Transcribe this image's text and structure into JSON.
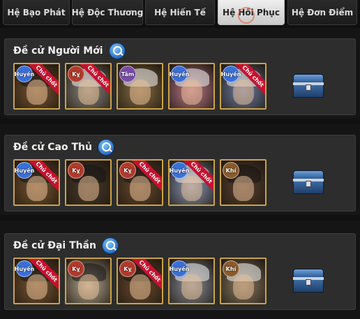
{
  "tabs": [
    {
      "label": "Hệ Bạo Phát",
      "active": false
    },
    {
      "label": "Hệ Độc Thương",
      "active": false
    },
    {
      "label": "Hệ Hiến Tế",
      "active": false
    },
    {
      "label": "Hệ Hồi Phục",
      "active": true
    },
    {
      "label": "Hệ Đơn Điểm",
      "active": false
    }
  ],
  "panels": [
    {
      "title": "Đề cử Người Mới",
      "heroes": [
        {
          "badge": "Huyền",
          "badge_color": "#3a6fd8",
          "ribbon": "Chủ chốt",
          "bg": "#7a5632",
          "hair": "dark"
        },
        {
          "badge": "Kỵ",
          "badge_color": "#b23a2a",
          "ribbon": "Chủ chốt",
          "bg": "#8d8a82",
          "hair": "light"
        },
        {
          "badge": "Tâm",
          "badge_color": "#7a4aa8",
          "ribbon": "",
          "bg": "#8a6e44",
          "hair": "light"
        },
        {
          "badge": "Huyền",
          "badge_color": "#3a6fd8",
          "ribbon": "",
          "bg": "#c07a8c",
          "hair": "light"
        },
        {
          "badge": "Huyền",
          "badge_color": "#3a6fd8",
          "ribbon": "Chủ chốt",
          "bg": "#6f7fa8",
          "hair": "light"
        }
      ]
    },
    {
      "title": "Đề cử Cao Thủ",
      "heroes": [
        {
          "badge": "Huyền",
          "badge_color": "#3a6fd8",
          "ribbon": "Chủ chốt",
          "bg": "#7a5632",
          "hair": "dark"
        },
        {
          "badge": "Kỵ",
          "badge_color": "#b23a2a",
          "ribbon": "",
          "bg": "#4a3a2c",
          "hair": "dark"
        },
        {
          "badge": "Kỵ",
          "badge_color": "#b23a2a",
          "ribbon": "Chủ chốt",
          "bg": "#6a4a2e",
          "hair": "dark"
        },
        {
          "badge": "Huyền",
          "badge_color": "#3a6fd8",
          "ribbon": "Chủ chốt",
          "bg": "#8c9ab8",
          "hair": "light"
        },
        {
          "badge": "Khí",
          "badge_color": "#8a5a2a",
          "ribbon": "",
          "bg": "#5a4030",
          "hair": "dark"
        }
      ]
    },
    {
      "title": "Đề cử Đại Thần",
      "heroes": [
        {
          "badge": "Huyền",
          "badge_color": "#3a6fd8",
          "ribbon": "Chủ chốt",
          "bg": "#7a5632",
          "hair": "dark"
        },
        {
          "badge": "Kỵ",
          "badge_color": "#b23a2a",
          "ribbon": "",
          "bg": "#b8aa94",
          "hair": "dark"
        },
        {
          "badge": "Kỵ",
          "badge_color": "#b23a2a",
          "ribbon": "Chủ chốt",
          "bg": "#6a4a2e",
          "hair": "dark"
        },
        {
          "badge": "Huyền",
          "badge_color": "#3a6fd8",
          "ribbon": "",
          "bg": "#8a8e98",
          "hair": "light"
        },
        {
          "badge": "Khí",
          "badge_color": "#8a5a2a",
          "ribbon": "",
          "bg": "#8a7a62",
          "hair": "light"
        }
      ]
    }
  ],
  "icons": {
    "search": "search-icon",
    "reward": "treasure-chest-icon"
  }
}
